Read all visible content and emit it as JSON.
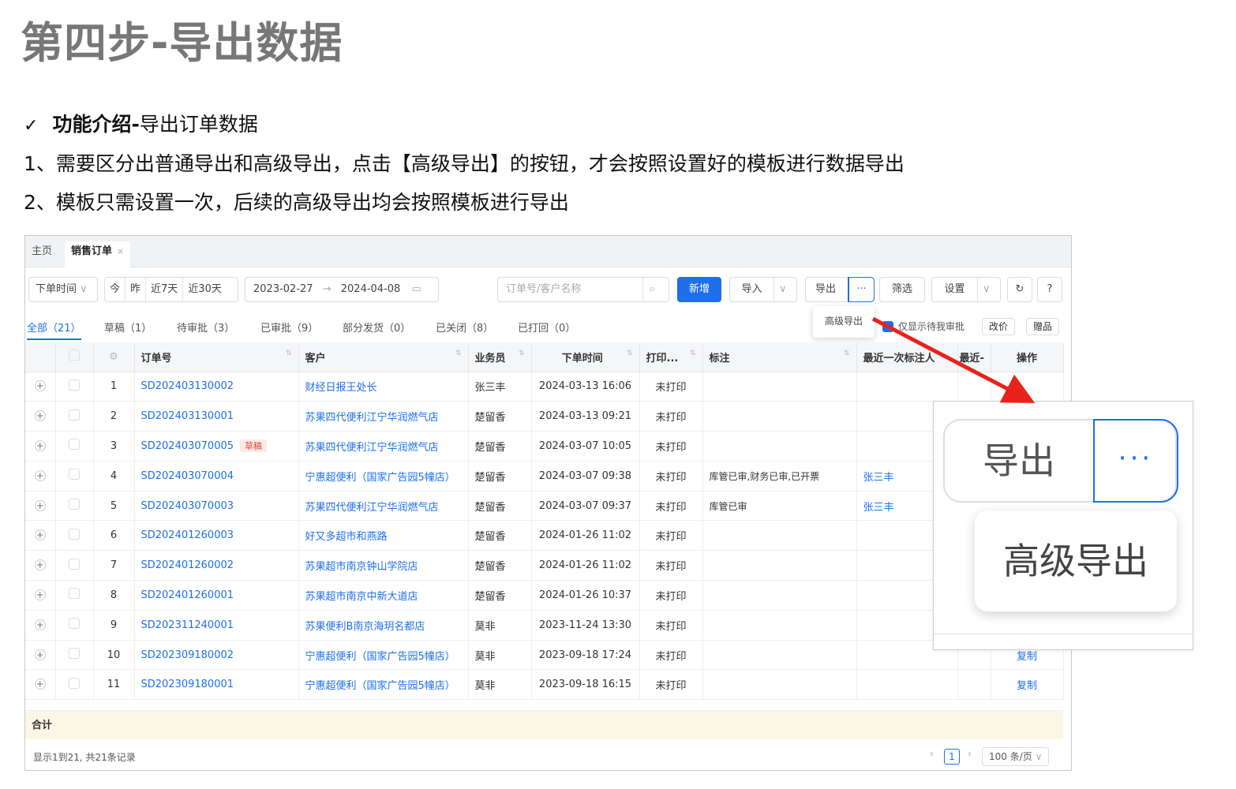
{
  "title": "第四步-导出数据",
  "intro": {
    "check_mark": "✓",
    "heading_bold": "功能介绍-",
    "heading_rest": "导出订单数据",
    "point1": "1、需要区分出普通导出和高级导出，点击【高级导出】的按钮，才会按照设置好的模板进行数据导出",
    "point2": "2、模板只需设置一次，后续的高级导出均会按照模板进行导出"
  },
  "app": {
    "tabs": {
      "home": "主页",
      "active": "销售订单",
      "close": "×"
    },
    "filters": {
      "time_select": "下单时间",
      "today": "今",
      "yesterday": "昨",
      "last7": "近7天",
      "last30": "近30天",
      "date_start": "2023-02-27",
      "date_sep": "→",
      "date_end": "2024-04-08",
      "search_placeholder": "订单号/客户名称"
    },
    "toolbar": {
      "new": "新增",
      "import": "导入",
      "export": "导出",
      "more": "···",
      "filter": "筛选",
      "settings": "设置"
    },
    "dropdown_item": "高级导出",
    "status_tabs": [
      "全部（21）",
      "草稿（1）",
      "待审批（3）",
      "已审批（9）",
      "部分发货（0）",
      "已关闭（8）",
      "已打回（0）"
    ],
    "only_my_approval": "仅显示待我审批",
    "price_change": "改价",
    "gift": "赠品",
    "columns": [
      "订单号",
      "客户",
      "业务员",
      "下单时间",
      "打印...",
      "标注",
      "最近一次标注人",
      "最近-",
      "操作"
    ],
    "rows": [
      {
        "no": "1",
        "order": "SD202403130002",
        "draft": "",
        "customer": "财经日报王处长",
        "sales": "张三丰",
        "time": "2024-03-13 16:06",
        "print": "未打印",
        "note": "",
        "noter": "",
        "op": ""
      },
      {
        "no": "2",
        "order": "SD202403130001",
        "draft": "",
        "customer": "苏果四代便利江宁华润燃气店",
        "sales": "楚留香",
        "time": "2024-03-13 09:21",
        "print": "未打印",
        "note": "",
        "noter": "",
        "op": ""
      },
      {
        "no": "3",
        "order": "SD202403070005",
        "draft": "草稿",
        "customer": "苏果四代便利江宁华润燃气店",
        "sales": "楚留香",
        "time": "2024-03-07 10:05",
        "print": "未打印",
        "note": "",
        "noter": "",
        "op": ""
      },
      {
        "no": "4",
        "order": "SD202403070004",
        "draft": "",
        "customer": "宁惠超便利（国家广告园5幢店）",
        "sales": "楚留香",
        "time": "2024-03-07 09:38",
        "print": "未打印",
        "note": "库管已审,财务已审,已开票",
        "noter": "张三丰",
        "op": ""
      },
      {
        "no": "5",
        "order": "SD202403070003",
        "draft": "",
        "customer": "苏果四代便利江宁华润燃气店",
        "sales": "楚留香",
        "time": "2024-03-07 09:37",
        "print": "未打印",
        "note": "库管已审",
        "noter": "张三丰",
        "op": ""
      },
      {
        "no": "6",
        "order": "SD202401260003",
        "draft": "",
        "customer": "好又多超市和燕路",
        "sales": "楚留香",
        "time": "2024-01-26 11:02",
        "print": "未打印",
        "note": "",
        "noter": "",
        "op": ""
      },
      {
        "no": "7",
        "order": "SD202401260002",
        "draft": "",
        "customer": "苏果超市南京钟山学院店",
        "sales": "楚留香",
        "time": "2024-01-26 11:02",
        "print": "未打印",
        "note": "",
        "noter": "",
        "op": ""
      },
      {
        "no": "8",
        "order": "SD202401260001",
        "draft": "",
        "customer": "苏果超市南京中新大道店",
        "sales": "楚留香",
        "time": "2024-01-26 10:37",
        "print": "未打印",
        "note": "",
        "noter": "",
        "op": ""
      },
      {
        "no": "9",
        "order": "SD202311240001",
        "draft": "",
        "customer": "苏果便利B南京海玥名都店",
        "sales": "莫非",
        "time": "2023-11-24 13:30",
        "print": "未打印",
        "note": "",
        "noter": "",
        "op": ""
      },
      {
        "no": "10",
        "order": "SD202309180002",
        "draft": "",
        "customer": "宁惠超便利（国家广告园5幢店）",
        "sales": "莫非",
        "time": "2023-09-18 17:24",
        "print": "未打印",
        "note": "",
        "noter": "",
        "op": "复制"
      },
      {
        "no": "11",
        "order": "SD202309180001",
        "draft": "",
        "customer": "宁惠超便利（国家广告园5幢店）",
        "sales": "莫非",
        "time": "2023-09-18 16:15",
        "print": "未打印",
        "note": "",
        "noter": "",
        "op": "复制"
      }
    ],
    "sum_label": "合计",
    "footer_text": "显示1到21, 共21条记录",
    "page": "1",
    "page_size": "100 条/页"
  },
  "zoom": {
    "export": "导出",
    "more": "···",
    "advanced_export": "高级导出"
  },
  "colors": {
    "accent": "#1e6fe8",
    "arrow": "#e8231c",
    "title_gray": "#777777"
  }
}
